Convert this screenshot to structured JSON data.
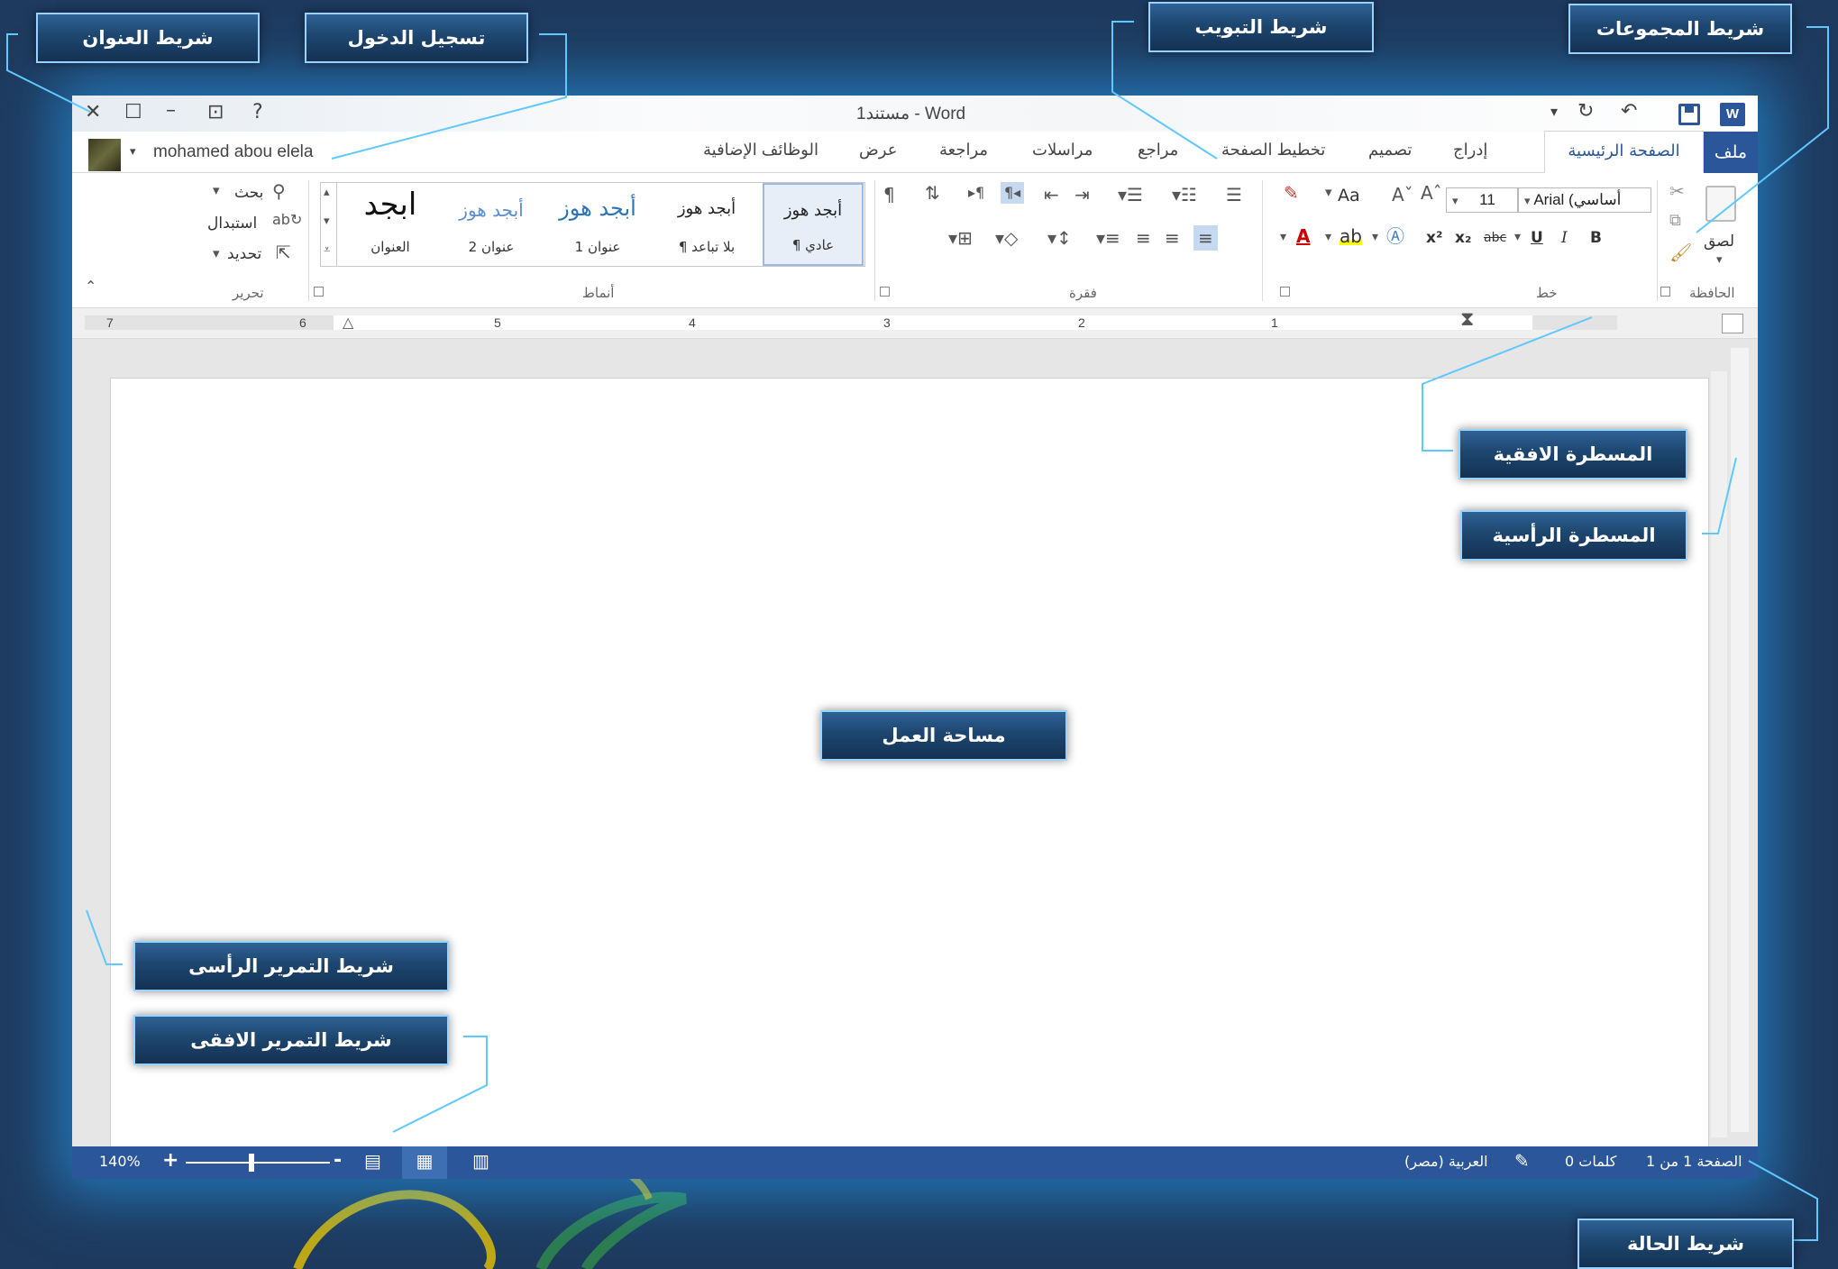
{
  "window": {
    "document_title": "مستند1 - Word",
    "user_name": "mohamed abou elela",
    "quick_access": [
      "word-logo-icon",
      "save-icon",
      "redo-icon",
      "undo-icon",
      "customize-icon"
    ],
    "window_controls": [
      "close-icon",
      "restore-icon",
      "minimize-icon",
      "ribbon-display-icon",
      "help-icon"
    ]
  },
  "tabs": [
    {
      "label": "ملف"
    },
    {
      "label": "الصفحة الرئيسية"
    },
    {
      "label": "إدراج"
    },
    {
      "label": "تصميم"
    },
    {
      "label": "تخطيط الصفحة"
    },
    {
      "label": "مراجع"
    },
    {
      "label": "مراسلات"
    },
    {
      "label": "مراجعة"
    },
    {
      "label": "عرض"
    },
    {
      "label": "الوظائف الإضافية"
    }
  ],
  "ribbon": {
    "clipboard": {
      "label": "الحافظة",
      "paste": "لصق"
    },
    "font": {
      "label": "خط",
      "font_name": "Arial (أساسي",
      "font_size": "11",
      "bold": "B",
      "italic": "I",
      "underline": "U",
      "strike": "abc",
      "subscript": "x₂",
      "superscript": "x²",
      "change_case": "Aa"
    },
    "paragraph": {
      "label": "فقرة",
      "show_marks": "¶"
    },
    "styles": {
      "label": "أنماط",
      "items": [
        {
          "sample": "أبجد هوز",
          "name": "¶ عادي"
        },
        {
          "sample": "أبجد هوز",
          "name": "¶ بلا تباعد"
        },
        {
          "sample": "أبجد هوز",
          "name": "عنوان 1"
        },
        {
          "sample": "أبجد هوز",
          "name": "عنوان 2"
        },
        {
          "sample": "ابجد",
          "name": "العنوان"
        }
      ]
    },
    "editing": {
      "label": "تحرير",
      "find": "بحث",
      "replace": "استبدال",
      "select": "تحديد"
    }
  },
  "ruler": {
    "numbers": [
      "1",
      "2",
      "3",
      "4",
      "5",
      "6",
      "7"
    ]
  },
  "statusbar": {
    "page": "الصفحة 1 من 1",
    "words": "0 كلمات",
    "language": "العربية (مصر)",
    "zoom": "140%",
    "zoom_plus": "+",
    "zoom_minus": "-"
  },
  "callouts": {
    "title_bar": "شريط العنوان",
    "sign_in": "تسجيل الدخول",
    "tab_bar": "شريط التبويب",
    "groups_bar": "شريط المجموعات",
    "horizontal_ruler": "المسطرة الافقية",
    "vertical_ruler": "المسطرة الرأسية",
    "work_area": "مساحة العمل",
    "vertical_scrollbar": "شريط التمرير الرأسى",
    "horizontal_scrollbar": "شريط التمرير الافقى",
    "status_bar": "شريط الحالة"
  },
  "colors": {
    "background": "#1e3a5e",
    "word_blue": "#2b579a",
    "callout_border": "#9ad2ff",
    "leader_line": "#5ec8ff"
  }
}
